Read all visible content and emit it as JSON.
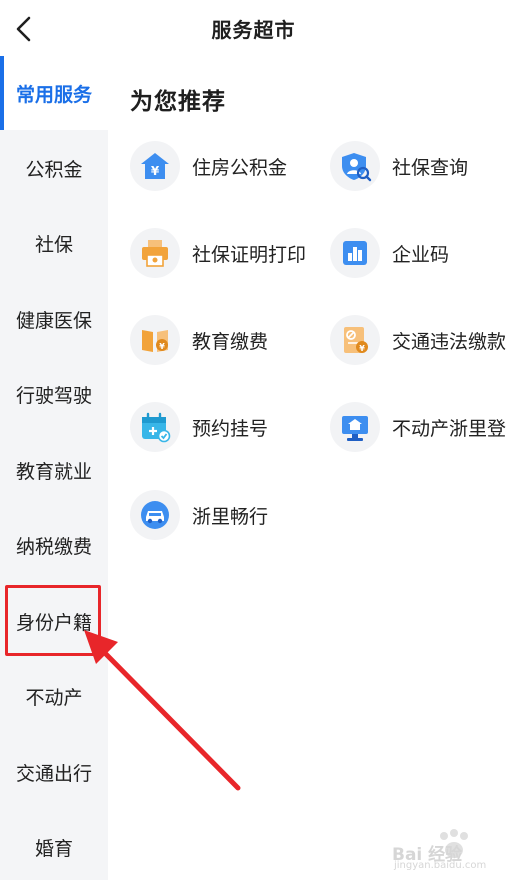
{
  "header": {
    "title": "服务超市",
    "back_icon": "back-arrow-icon"
  },
  "sidebar": {
    "active_color": "#1a6fe8",
    "items": [
      {
        "label": "常用服务",
        "active": true
      },
      {
        "label": "公积金"
      },
      {
        "label": "社保"
      },
      {
        "label": "健康医保"
      },
      {
        "label": "行驶驾驶"
      },
      {
        "label": "教育就业"
      },
      {
        "label": "纳税缴费"
      },
      {
        "label": "身份户籍",
        "highlighted": true
      },
      {
        "label": "不动产"
      },
      {
        "label": "交通出行"
      },
      {
        "label": "婚育"
      }
    ]
  },
  "main": {
    "section_title": "为您推荐",
    "services": [
      {
        "label": "住房公积金",
        "icon": "housing-fund-icon",
        "color": "#3d8ef0"
      },
      {
        "label": "社保查询",
        "icon": "social-security-query-icon",
        "color": "#3d8ef0"
      },
      {
        "label": "社保证明打印",
        "icon": "printer-icon",
        "color": "#f2a33a"
      },
      {
        "label": "企业码",
        "icon": "enterprise-code-icon",
        "color": "#3d8ef0"
      },
      {
        "label": "教育缴费",
        "icon": "education-payment-icon",
        "color": "#f2a33a"
      },
      {
        "label": "交通违法缴款",
        "icon": "traffic-fine-icon",
        "color": "#f2a33a"
      },
      {
        "label": "预约挂号",
        "icon": "calendar-add-icon",
        "color": "#38b6e8"
      },
      {
        "label": "不动产浙里登",
        "icon": "property-registration-icon",
        "color": "#3d8ef0"
      },
      {
        "label": "浙里畅行",
        "icon": "car-icon",
        "color": "#3d8ef0"
      }
    ]
  },
  "annotation": {
    "color": "#e8262a"
  },
  "watermark": {
    "text": "Bai 经验",
    "sub": "jingyan.baidu.com"
  }
}
